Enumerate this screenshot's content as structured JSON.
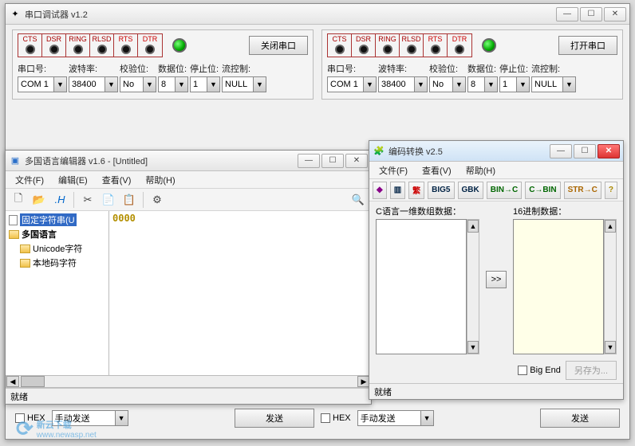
{
  "serial": {
    "title": "串口调试器 v1.2",
    "indicators": [
      "CTS",
      "DSR",
      "RING",
      "RLSD",
      "RTS",
      "DTR"
    ],
    "left": {
      "action_btn": "关闭串口",
      "params": {
        "port_label": "串口号:",
        "port": "COM 1",
        "baud_label": "波特率:",
        "baud": "38400",
        "parity_label": "校验位:",
        "parity": "No",
        "data_label": "数据位:",
        "data": "8",
        "stop_label": "停止位:",
        "stop": "1",
        "flow_label": "流控制:",
        "flow": "NULL"
      }
    },
    "right": {
      "action_btn": "打开串口",
      "params": {
        "port_label": "串口号:",
        "port": "COM 1",
        "baud_label": "波特率:",
        "baud": "38400",
        "parity_label": "校验位:",
        "parity": "No",
        "data_label": "数据位:",
        "data": "8",
        "stop_label": "停止位:",
        "stop": "1",
        "flow_label": "流控制:",
        "flow": "NULL"
      }
    },
    "bottom": {
      "hex": "HEX",
      "send_mode": "手动发送",
      "send_btn": "发送"
    }
  },
  "editor": {
    "title": "多国语言编辑器 v1.6 - [Untitled]",
    "menu": {
      "file": "文件(F)",
      "edit": "编辑(E)",
      "view": "查看(V)",
      "help": "帮助(H)"
    },
    "tree": {
      "fixed": "固定字符串(U",
      "root": "多国语言",
      "unicode": "Unicode字符",
      "local": "本地码字符"
    },
    "hex": "0000",
    "status": "就绪"
  },
  "encoder": {
    "title": "编码转换 v2.5",
    "menu": {
      "file": "文件(F)",
      "view": "查看(V)",
      "help": "帮助(H)"
    },
    "toolbar": {
      "fan": "繁",
      "big5": "BIG5",
      "gbk": "GBK",
      "bin_c": "BIN→C",
      "c_bin": "C→BIN",
      "str_c": "STR→C",
      "help": "?"
    },
    "left_label": "C语言一维数组数据：",
    "right_label": "16进制数据：",
    "transfer": ">>",
    "bigend": "Big End",
    "saveas": "另存为...",
    "status": "就绪"
  },
  "watermark": {
    "name": "新云下载",
    "url": "www.newasp.net"
  }
}
